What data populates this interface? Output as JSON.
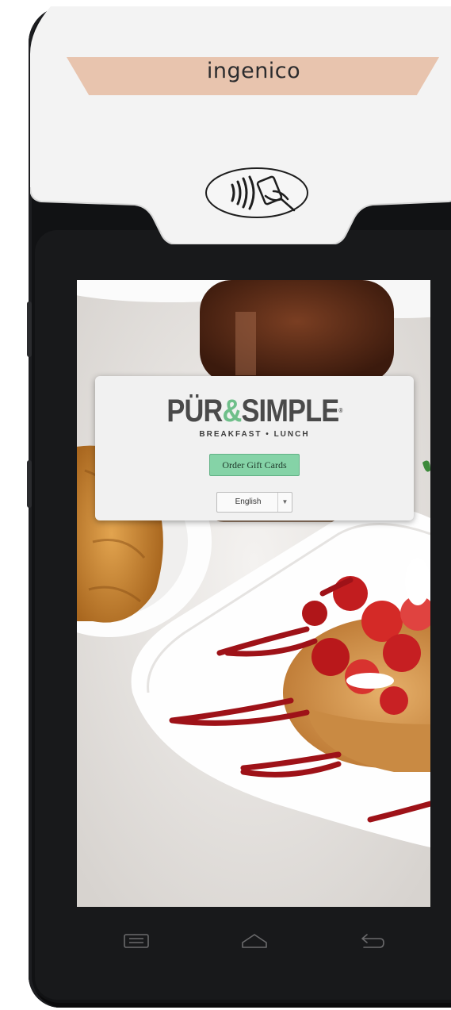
{
  "device": {
    "brand": "ingenico",
    "contactless_icon": "contactless-payment-icon"
  },
  "dialog": {
    "logo": {
      "part1": "PÜR",
      "ampersand": "&",
      "part2": "SIMPLE",
      "registered": "®",
      "tagline": "BREAKFAST • LUNCH"
    },
    "order_button_label": "Order Gift Cards",
    "language": {
      "selected": "English"
    }
  },
  "navbar": {
    "recent_icon": "recent-apps-icon",
    "home_icon": "home-icon",
    "back_icon": "back-icon"
  },
  "colors": {
    "accent_green": "#85d3a7",
    "logo_green": "#6fbf8a",
    "brand_band": "#e8c4ae",
    "device_body": "#111214"
  }
}
